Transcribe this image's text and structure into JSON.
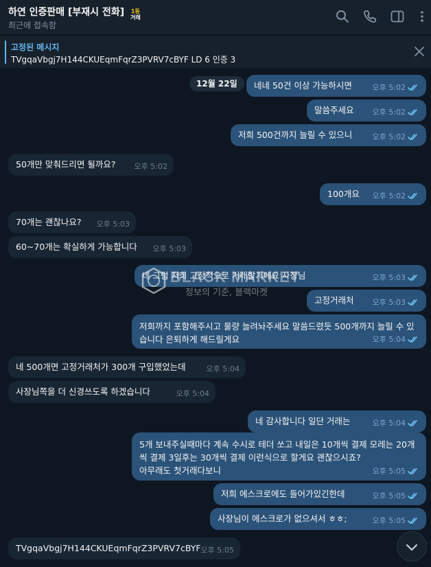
{
  "header": {
    "title": "하연 인증판매 [부재시 전화]",
    "badge_top": "1등",
    "badge_bottom": "거래",
    "subtitle": "최근에 접속함",
    "icons": [
      "search-icon",
      "phone-icon",
      "sidebar-toggle-icon",
      "more-icon"
    ]
  },
  "pinned": {
    "label": "고정된 메시지",
    "text": "TVgqaVbgj7H144CKUEqmFqrZ3PVRV7cBYF LD 6 인증 3"
  },
  "chat": {
    "date_badge": "12월 22일",
    "messages": [
      {
        "dir": "out",
        "text": "네네 50건 이상 가능하시면",
        "time": "오후 5:02"
      },
      {
        "dir": "out",
        "text": "말씀주세요",
        "time": "오후 5:02"
      },
      {
        "dir": "out",
        "text": "저희 500건까지 늘릴 수 있으니",
        "time": "오후 5:02"
      },
      {
        "dir": "in",
        "text": "50개만 맞춰드리면 될까요?",
        "time": "오후 5:02"
      },
      {
        "dir": "out",
        "text": "100개요",
        "time": "오후 5:02"
      },
      {
        "dir": "in",
        "text": "70개는 괜찮나요?",
        "time": "오후 5:03"
      },
      {
        "dir": "in",
        "text": "60~70개는 확실하게 가능합니다",
        "time": "오후 5:03"
      },
      {
        "dir": "out",
        "text": "네 그럼 저희 고정적으로 거래할거에요 사장님",
        "time": "오후 5:03"
      },
      {
        "dir": "out",
        "text": "고정거래처",
        "time": "오후 5:03"
      },
      {
        "dir": "out",
        "text": "저희까지 포함해주시고 물량 늘려놔주세요 말씀드렸듯 500개까지 늘릴 수 있습니다 은퇴하게 해드릴게요",
        "time": "오후 5:04"
      },
      {
        "dir": "in",
        "text": "네 500개면 고정거래처가 300개 구입했었는데",
        "time": "오후 5:04"
      },
      {
        "dir": "in",
        "text": "사장님쪽을 더 신경쓰도록 하겠습니다",
        "time": "오후 5:04"
      },
      {
        "dir": "out",
        "text": "네 감사합니다 일단 거래는",
        "time": "오후 5:04"
      },
      {
        "dir": "out",
        "text": "5개 보내주실때마다 계속 수시로 테더 쏘고 내일은 10개씩 결제 모레는 20개씩 결제 3일후는 30개씩 결제 이런식으로 할게요 괜찮으시죠?\n아무래도 첫거래다보니",
        "time": "오후 5:05"
      },
      {
        "dir": "out",
        "text": "저희 에스크로에도 들어가있긴한데",
        "time": "오후 5:05"
      },
      {
        "dir": "out",
        "text": "사장님이 에스크로가 없으셔서 ㅎㅎ;",
        "time": "오후 5:05"
      },
      {
        "dir": "in",
        "text": "TVgqaVbgj7H144CKUEqmFqrZ3PVRV7cBYF",
        "time": "오후 5:05"
      }
    ]
  },
  "watermark": {
    "logo_text": "BLACK MARKET",
    "title": "BLACK MARKET",
    "subtitle": "정보의 기준, 블랙마켓"
  },
  "colors": {
    "background": "#0e1621",
    "header": "#17212b",
    "outgoing_bubble": "#2b5278",
    "incoming_bubble": "#182533",
    "accent": "#64b5ef"
  }
}
